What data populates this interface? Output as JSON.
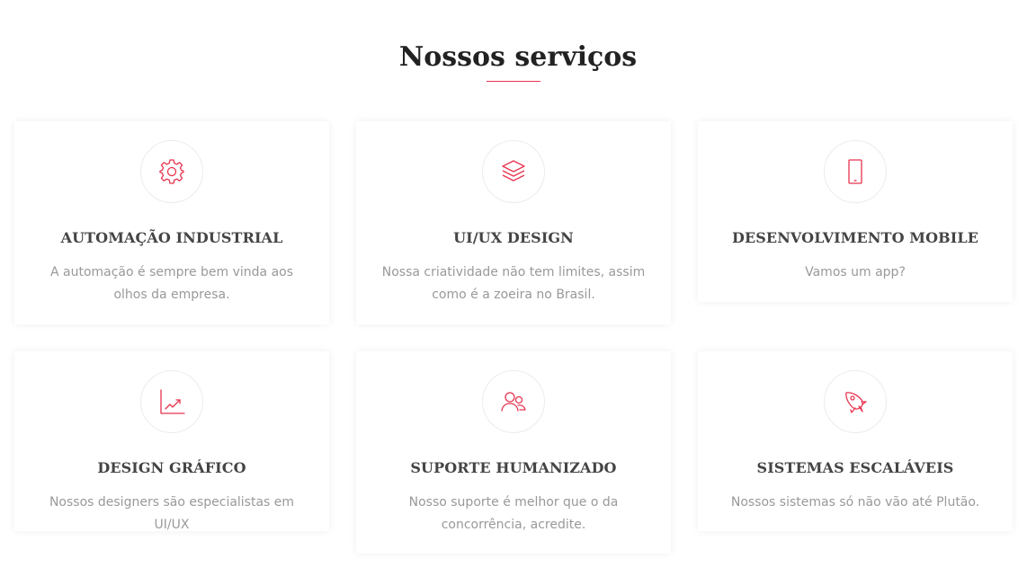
{
  "section": {
    "title": "Nossos serviços",
    "accent_color": "#e8334f"
  },
  "services": [
    {
      "title": "AUTOMAÇÃO INDUSTRIAL",
      "description": "A automação é sempre bem vinda aos olhos da empresa.",
      "icon": "gear-icon"
    },
    {
      "title": "UI/UX DESIGN",
      "description": "Nossa criatividade não tem limites, assim como é a zoeira no Brasil.",
      "icon": "layers-icon"
    },
    {
      "title": "DESENVOLVIMENTO MOBILE",
      "description": "Vamos um app?",
      "icon": "mobile-phone-icon"
    },
    {
      "title": "DESIGN GRÁFICO",
      "description": "Nossos designers são especialistas em UI/UX",
      "icon": "chart-icon"
    },
    {
      "title": "SUPORTE HUMANIZADO",
      "description": "Nosso suporte é melhor que o da concorrência, acredite.",
      "icon": "users-icon"
    },
    {
      "title": "SISTEMAS ESCALÁVEIS",
      "description": "Nossos sistemas só não vão até Plutão.",
      "icon": "rocket-icon"
    }
  ]
}
